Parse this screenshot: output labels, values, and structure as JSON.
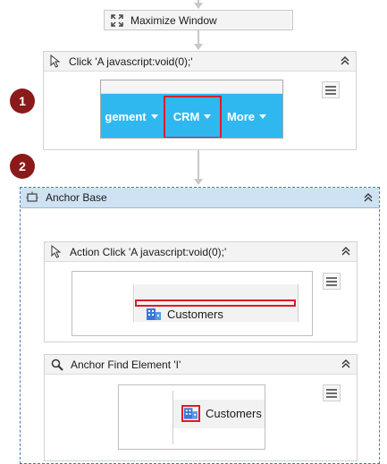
{
  "workflow": {
    "maximize_step": {
      "label": "Maximize Window",
      "icon": "maximize-icon"
    },
    "click_step": {
      "title": "Click 'A  javascript:void(0);'",
      "icon": "pointer-icon",
      "preview": {
        "nav_items": [
          "gement",
          "CRM",
          "More"
        ],
        "highlighted_item": "CRM"
      }
    },
    "badges": [
      "1",
      "2"
    ],
    "anchor_base": {
      "title": "Anchor Base",
      "icon": "anchor-base-icon",
      "action_click": {
        "title": "Action Click 'A  javascript:void(0);'",
        "icon": "pointer-icon",
        "preview_label": "Customers"
      },
      "anchor_find": {
        "title": "Anchor Find Element 'I'",
        "icon": "search-icon",
        "preview_label": "Customers"
      }
    }
  },
  "colors": {
    "badge": "#8b1a1a",
    "nav_blue": "#2fb8f0",
    "highlight_red": "#e01b24",
    "anchor_header": "#cfe2f3",
    "anchor_border": "#4a78b8"
  }
}
